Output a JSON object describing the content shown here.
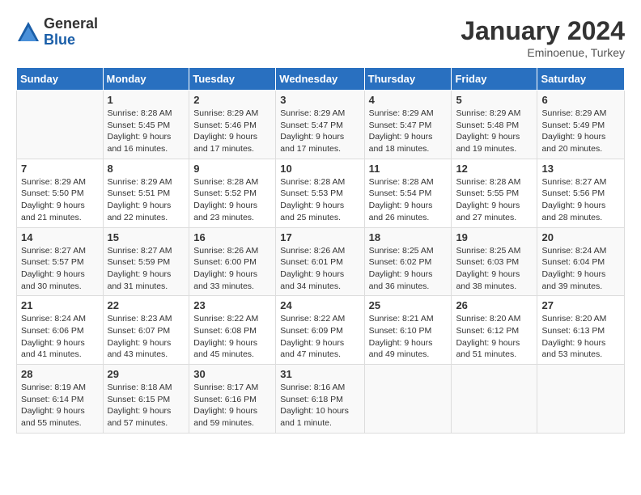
{
  "header": {
    "logo_general": "General",
    "logo_blue": "Blue",
    "month_title": "January 2024",
    "subtitle": "Eminoenue, Turkey"
  },
  "days_of_week": [
    "Sunday",
    "Monday",
    "Tuesday",
    "Wednesday",
    "Thursday",
    "Friday",
    "Saturday"
  ],
  "weeks": [
    [
      {
        "day": "",
        "info": ""
      },
      {
        "day": "1",
        "info": "Sunrise: 8:28 AM\nSunset: 5:45 PM\nDaylight: 9 hours\nand 16 minutes."
      },
      {
        "day": "2",
        "info": "Sunrise: 8:29 AM\nSunset: 5:46 PM\nDaylight: 9 hours\nand 17 minutes."
      },
      {
        "day": "3",
        "info": "Sunrise: 8:29 AM\nSunset: 5:47 PM\nDaylight: 9 hours\nand 17 minutes."
      },
      {
        "day": "4",
        "info": "Sunrise: 8:29 AM\nSunset: 5:47 PM\nDaylight: 9 hours\nand 18 minutes."
      },
      {
        "day": "5",
        "info": "Sunrise: 8:29 AM\nSunset: 5:48 PM\nDaylight: 9 hours\nand 19 minutes."
      },
      {
        "day": "6",
        "info": "Sunrise: 8:29 AM\nSunset: 5:49 PM\nDaylight: 9 hours\nand 20 minutes."
      }
    ],
    [
      {
        "day": "7",
        "info": "Sunrise: 8:29 AM\nSunset: 5:50 PM\nDaylight: 9 hours\nand 21 minutes."
      },
      {
        "day": "8",
        "info": "Sunrise: 8:29 AM\nSunset: 5:51 PM\nDaylight: 9 hours\nand 22 minutes."
      },
      {
        "day": "9",
        "info": "Sunrise: 8:28 AM\nSunset: 5:52 PM\nDaylight: 9 hours\nand 23 minutes."
      },
      {
        "day": "10",
        "info": "Sunrise: 8:28 AM\nSunset: 5:53 PM\nDaylight: 9 hours\nand 25 minutes."
      },
      {
        "day": "11",
        "info": "Sunrise: 8:28 AM\nSunset: 5:54 PM\nDaylight: 9 hours\nand 26 minutes."
      },
      {
        "day": "12",
        "info": "Sunrise: 8:28 AM\nSunset: 5:55 PM\nDaylight: 9 hours\nand 27 minutes."
      },
      {
        "day": "13",
        "info": "Sunrise: 8:27 AM\nSunset: 5:56 PM\nDaylight: 9 hours\nand 28 minutes."
      }
    ],
    [
      {
        "day": "14",
        "info": "Sunrise: 8:27 AM\nSunset: 5:57 PM\nDaylight: 9 hours\nand 30 minutes."
      },
      {
        "day": "15",
        "info": "Sunrise: 8:27 AM\nSunset: 5:59 PM\nDaylight: 9 hours\nand 31 minutes."
      },
      {
        "day": "16",
        "info": "Sunrise: 8:26 AM\nSunset: 6:00 PM\nDaylight: 9 hours\nand 33 minutes."
      },
      {
        "day": "17",
        "info": "Sunrise: 8:26 AM\nSunset: 6:01 PM\nDaylight: 9 hours\nand 34 minutes."
      },
      {
        "day": "18",
        "info": "Sunrise: 8:25 AM\nSunset: 6:02 PM\nDaylight: 9 hours\nand 36 minutes."
      },
      {
        "day": "19",
        "info": "Sunrise: 8:25 AM\nSunset: 6:03 PM\nDaylight: 9 hours\nand 38 minutes."
      },
      {
        "day": "20",
        "info": "Sunrise: 8:24 AM\nSunset: 6:04 PM\nDaylight: 9 hours\nand 39 minutes."
      }
    ],
    [
      {
        "day": "21",
        "info": "Sunrise: 8:24 AM\nSunset: 6:06 PM\nDaylight: 9 hours\nand 41 minutes."
      },
      {
        "day": "22",
        "info": "Sunrise: 8:23 AM\nSunset: 6:07 PM\nDaylight: 9 hours\nand 43 minutes."
      },
      {
        "day": "23",
        "info": "Sunrise: 8:22 AM\nSunset: 6:08 PM\nDaylight: 9 hours\nand 45 minutes."
      },
      {
        "day": "24",
        "info": "Sunrise: 8:22 AM\nSunset: 6:09 PM\nDaylight: 9 hours\nand 47 minutes."
      },
      {
        "day": "25",
        "info": "Sunrise: 8:21 AM\nSunset: 6:10 PM\nDaylight: 9 hours\nand 49 minutes."
      },
      {
        "day": "26",
        "info": "Sunrise: 8:20 AM\nSunset: 6:12 PM\nDaylight: 9 hours\nand 51 minutes."
      },
      {
        "day": "27",
        "info": "Sunrise: 8:20 AM\nSunset: 6:13 PM\nDaylight: 9 hours\nand 53 minutes."
      }
    ],
    [
      {
        "day": "28",
        "info": "Sunrise: 8:19 AM\nSunset: 6:14 PM\nDaylight: 9 hours\nand 55 minutes."
      },
      {
        "day": "29",
        "info": "Sunrise: 8:18 AM\nSunset: 6:15 PM\nDaylight: 9 hours\nand 57 minutes."
      },
      {
        "day": "30",
        "info": "Sunrise: 8:17 AM\nSunset: 6:16 PM\nDaylight: 9 hours\nand 59 minutes."
      },
      {
        "day": "31",
        "info": "Sunrise: 8:16 AM\nSunset: 6:18 PM\nDaylight: 10 hours\nand 1 minute."
      },
      {
        "day": "",
        "info": ""
      },
      {
        "day": "",
        "info": ""
      },
      {
        "day": "",
        "info": ""
      }
    ]
  ]
}
